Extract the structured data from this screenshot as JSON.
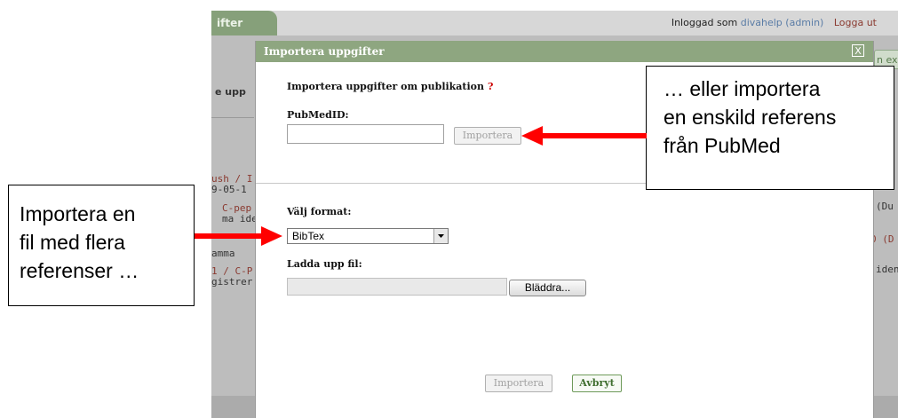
{
  "background_app": {
    "tab_label": "ifter",
    "login_prefix": "Inloggad som",
    "login_user": "divahelp (admin)",
    "logout_label": "Logga ut",
    "side_heading": "e upp",
    "right_button_partial": "n ex",
    "rows_left": [
      {
        "line1": "ush / I",
        "line2": "9-05-1"
      },
      {
        "line1": "C-pep",
        "line2": "ma ide"
      },
      {
        "line1": "",
        "line2": "amma"
      },
      {
        "line1": "1 / C-P",
        "line2": "gistrer"
      }
    ],
    "rows_right": [
      "(Du",
      "0 (D",
      "iden"
    ]
  },
  "dialog": {
    "title": "Importera uppgifter",
    "close_symbol": "X",
    "section_heading": "Importera uppgifter om publikation",
    "help_marker": "?",
    "pubmed_label": "PubMedID:",
    "pubmed_value": "",
    "pubmed_import_button": "Importera",
    "format_label": "Välj format:",
    "format_selected": "BibTex",
    "upload_label": "Ladda upp fil:",
    "upload_value": "",
    "browse_button": "Bläddra...",
    "import_button": "Importera",
    "cancel_button": "Avbryt"
  },
  "callouts": {
    "right": {
      "lines": [
        "… eller importera",
        "en enskild referens",
        "från PubMed"
      ]
    },
    "left": {
      "lines": [
        "Importera en",
        "fil med flera",
        "referenser …"
      ]
    }
  },
  "colors": {
    "titlebar": "#8ea680",
    "arrow": "#ff0000",
    "overlay": "#bdbdbd",
    "help_marker": "#cc0000"
  }
}
